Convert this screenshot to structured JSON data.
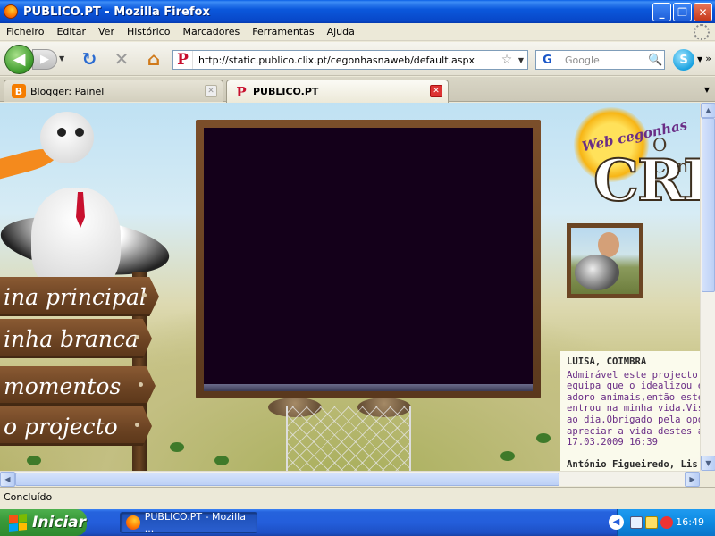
{
  "window": {
    "title": "PUBLICO.PT - Mozilla Firefox"
  },
  "menu": [
    "Ficheiro",
    "Editar",
    "Ver",
    "Histórico",
    "Marcadores",
    "Ferramentas",
    "Ajuda"
  ],
  "toolbar": {
    "url": "http://static.publico.clix.pt/cegonhasnaweb/default.aspx",
    "search_placeholder": "Google",
    "search_engine": "G"
  },
  "tabs": [
    {
      "label": "Blogger: Painel",
      "active": false
    },
    {
      "label": "PUBLICO.PT",
      "active": true
    }
  ],
  "page": {
    "signs": [
      "ina principal",
      "inha branca",
      "momentos",
      "o projecto"
    ],
    "logo_web": "Web cegonhas",
    "logo_o": "O Con",
    "logo_main": "CRE",
    "comment": {
      "author": "LUISA, COIMBRA",
      "lines": [
        "Admirável este projecto! P",
        "equipa que o idealizou e q",
        "adoro animais,então este",
        "entrou na minha vida.Visit",
        "ao dia.Obrigado pela opor",
        "apreciar a vida destes ani",
        "17.03.2009 16:39"
      ],
      "next_author": "António Figueiredo, Lis"
    }
  },
  "status": {
    "text": "Concluído"
  },
  "taskbar": {
    "start_label": "Iniciar",
    "task_label": "PUBLICO.PT - Mozilla ...",
    "clock": "16:49"
  },
  "colors": {
    "title_blue": "#0b58dc",
    "start_green": "#3a9a3a",
    "publico_red": "#c8102e",
    "video_bg": "#14001a"
  }
}
